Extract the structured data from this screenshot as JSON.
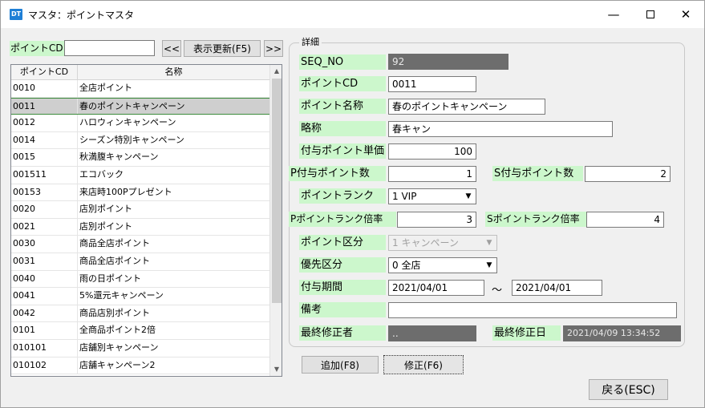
{
  "window": {
    "icon_text": "DT",
    "title": "マスタ：ポイントマスタ",
    "min_glyph": "—",
    "close_glyph": "✕"
  },
  "search": {
    "label": "ポイントCD",
    "value": "",
    "prev_label": "<<",
    "refresh_label": "表示更新(F5)",
    "next_label": ">>"
  },
  "grid": {
    "headers": {
      "id": "ポイントCD",
      "name": "名称"
    },
    "selected_index": 1,
    "rows": [
      {
        "id": "0010",
        "name": "全店ポイント"
      },
      {
        "id": "0011",
        "name": "春のポイントキャンペーン"
      },
      {
        "id": "0012",
        "name": "ハロウィンキャンペーン"
      },
      {
        "id": "0014",
        "name": "シーズン特別キャンペーン"
      },
      {
        "id": "0015",
        "name": "秋満腹キャンペーン"
      },
      {
        "id": "001511",
        "name": "エコバック"
      },
      {
        "id": "00153",
        "name": "来店時100Pプレゼント"
      },
      {
        "id": "0020",
        "name": "店別ポイント"
      },
      {
        "id": "0021",
        "name": "店別ポイント"
      },
      {
        "id": "0030",
        "name": "商品全店ポイント"
      },
      {
        "id": "0031",
        "name": "商品全店ポイント"
      },
      {
        "id": "0040",
        "name": "雨の日ポイント"
      },
      {
        "id": "0041",
        "name": "5%還元キャンペーン"
      },
      {
        "id": "0042",
        "name": "商品店別ポイント"
      },
      {
        "id": "0101",
        "name": "全商品ポイント2倍"
      },
      {
        "id": "010101",
        "name": "店舗別キャンペーン"
      },
      {
        "id": "010102",
        "name": "店舗キャンペーン2"
      }
    ],
    "scroll_up": "▲",
    "scroll_down": "▼"
  },
  "detail": {
    "legend": "詳細",
    "seq_no": {
      "label": "SEQ_NO",
      "value": "92"
    },
    "point_cd": {
      "label": "ポイントCD",
      "value": "0011"
    },
    "point_name": {
      "label": "ポイント名称",
      "value": "春のポイントキャンペーン"
    },
    "short_name": {
      "label": "略称",
      "value": "春キャン"
    },
    "unit_price": {
      "label": "付与ポイント単価",
      "value": "100"
    },
    "p_points": {
      "label": "P付与ポイント数",
      "value": "1"
    },
    "s_points": {
      "label": "S付与ポイント数",
      "value": "2"
    },
    "rank": {
      "label": "ポイントランク",
      "value": "1 VIP"
    },
    "p_rank_mult": {
      "label": "Pポイントランク倍率",
      "value": "3"
    },
    "s_rank_mult": {
      "label": "Sポイントランク倍率",
      "value": "4"
    },
    "category": {
      "label": "ポイント区分",
      "value": "1 キャンペーン"
    },
    "priority": {
      "label": "優先区分",
      "value": "0 全店"
    },
    "period": {
      "label": "付与期間",
      "start": "2021/04/01",
      "separator": "～",
      "end": "2021/04/01"
    },
    "remarks": {
      "label": "備考",
      "value": ""
    },
    "last_editor": {
      "label": "最終修正者",
      "value": ".."
    },
    "last_modified": {
      "label": "最終修正日",
      "value": "2021/04/09 13:34:52"
    },
    "combo_arrow": "▼"
  },
  "buttons": {
    "add": "追加(F8)",
    "edit": "修正(F6)",
    "back": "戻る(ESC)"
  }
}
